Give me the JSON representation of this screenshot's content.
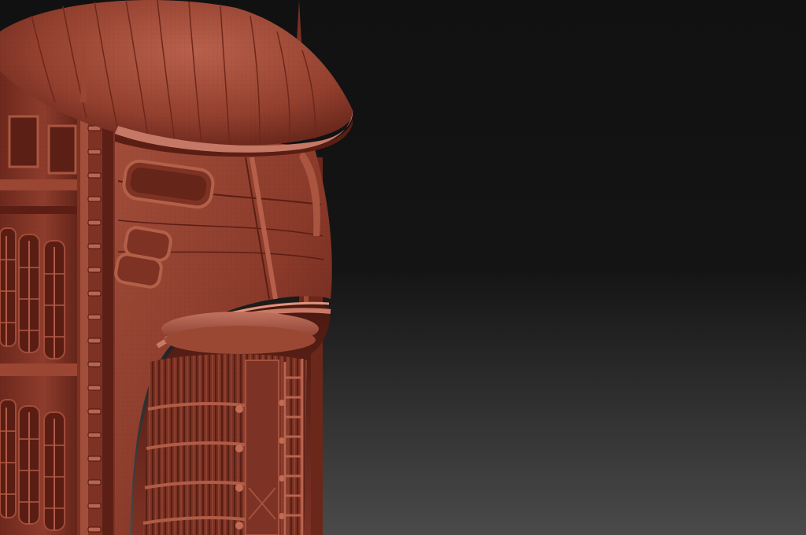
{
  "scene": {
    "subject": "sculpted-building-tower",
    "material_color": "#8a3a2c",
    "material_highlight": "#c0705c",
    "material_shadow": "#3e140e",
    "background_top": "#111111",
    "background_bottom": "#4a4a4a"
  }
}
